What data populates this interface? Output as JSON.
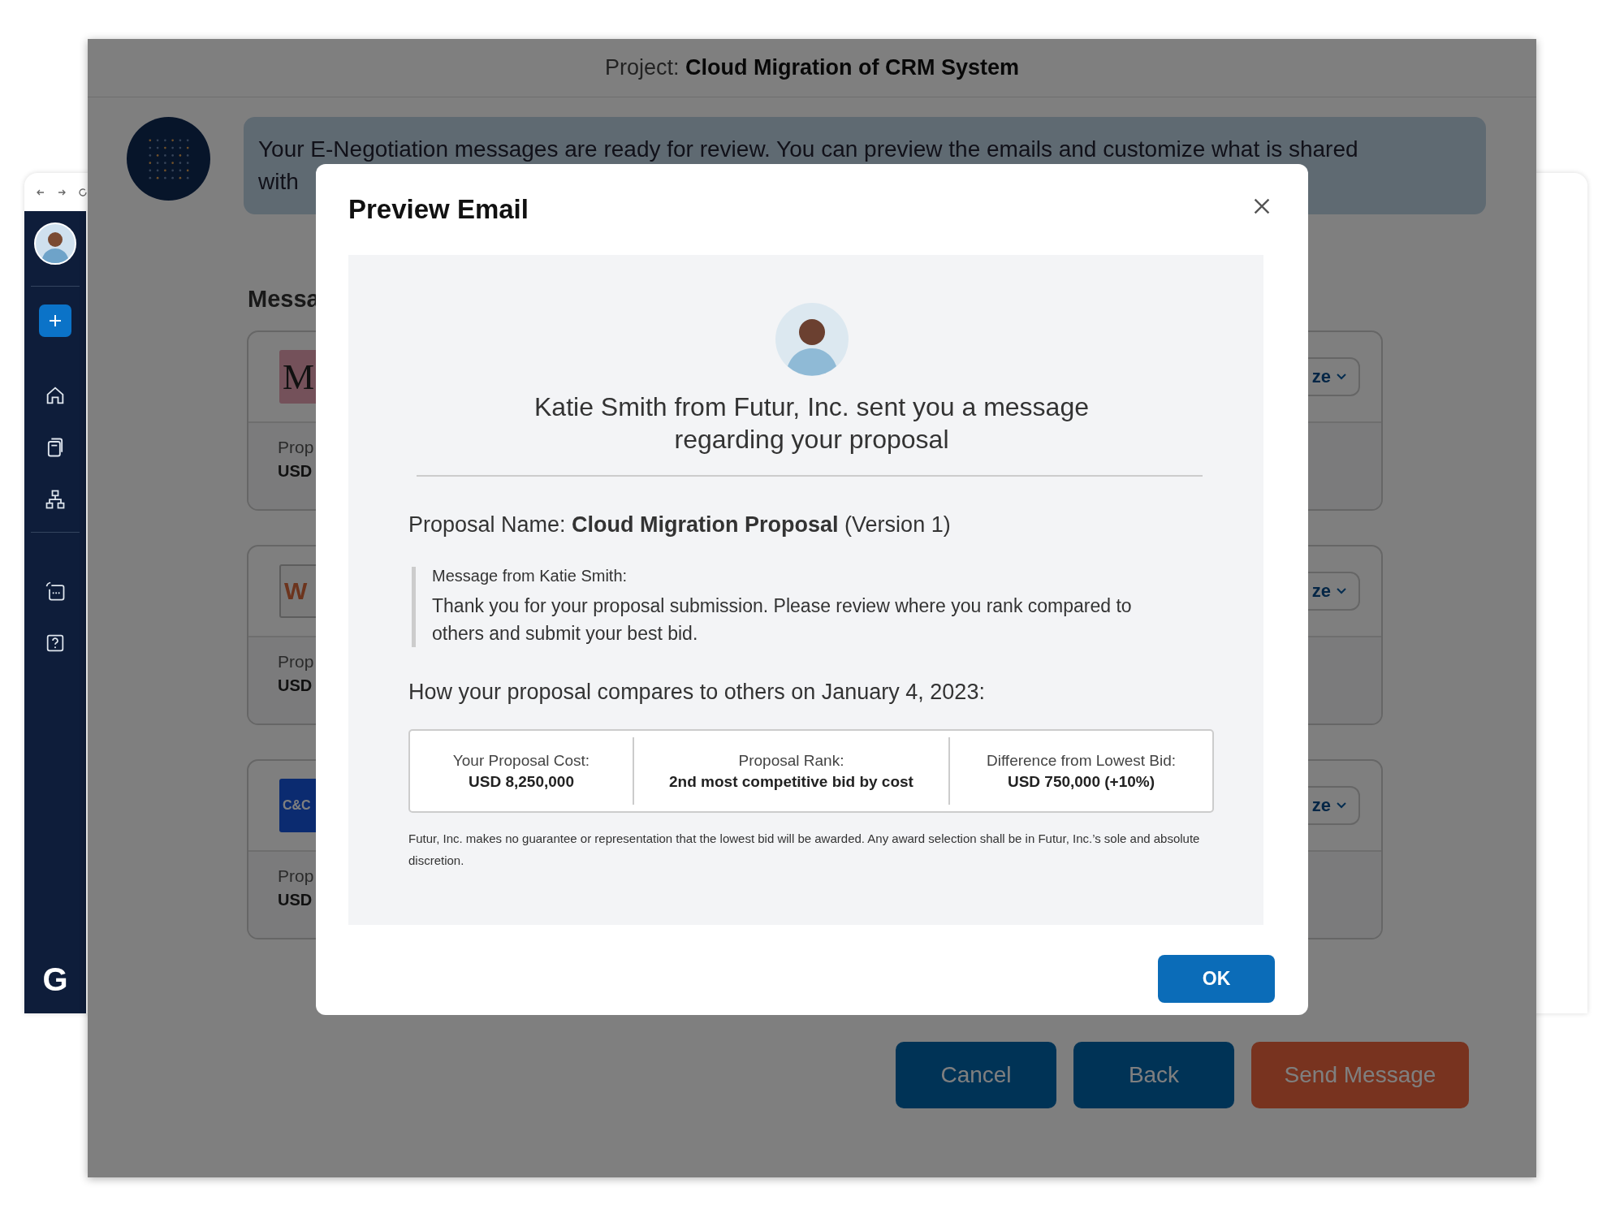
{
  "background_window": {
    "sidebar": {
      "items": [
        {
          "kind": "avatar"
        },
        {
          "kind": "add"
        },
        {
          "kind": "home"
        },
        {
          "kind": "documents"
        },
        {
          "kind": "hierarchy"
        },
        {
          "kind": "chat"
        },
        {
          "kind": "help"
        }
      ],
      "logo": "G"
    }
  },
  "main_window": {
    "project_label": "Project:",
    "project_name": "Cloud Migration of CRM System",
    "assistant_message_lines": [
      "Your E-Negotiation messages are ready for review. You can preview the emails and customize what is shared",
      "with"
    ],
    "section_title": "Messa",
    "cards": [
      {
        "logo": "M",
        "kind": "serif",
        "label": "Prop",
        "value": "USD",
        "action": "ze"
      },
      {
        "logo": "W",
        "kind": "outline",
        "label": "Prop",
        "value": "USD",
        "action": "ze"
      },
      {
        "logo": "C&C",
        "kind": "filled",
        "label": "Prop",
        "value": "USD",
        "action": "ze"
      }
    ],
    "buttons": [
      {
        "label": "Cancel",
        "kind": "secondary"
      },
      {
        "label": "Back",
        "kind": "secondary"
      },
      {
        "label": "Send Message",
        "kind": "primary"
      }
    ]
  },
  "modal": {
    "title": "Preview Email",
    "sender_line": "Katie Smith from Futur, Inc. sent you a message regarding your proposal",
    "proposal_line": "Proposal Name: **Cloud Migration Proposal** (Version 1)",
    "message_label": "Message from Katie Smith:",
    "message_body": "Thank you for your proposal submission. Please review where you rank compared to others and submit your best bid.",
    "comparison_heading": "How your proposal compares to others on January 4, 2023:",
    "stats": [
      {
        "label": "Your Proposal Cost:",
        "value": "USD 8,250,000"
      },
      {
        "label": "Proposal Rank:",
        "value": "2nd most competitive bid by cost"
      },
      {
        "label": "Difference from Lowest Bid:",
        "value": "USD 750,000 (+10%)"
      }
    ],
    "disclaimer": "Futur, Inc. makes no guarantee or representation that the lowest bid will be awarded. Any award selection shall be in Futur, Inc.’s sole and absolute discretion.",
    "ok_button": "OK"
  }
}
